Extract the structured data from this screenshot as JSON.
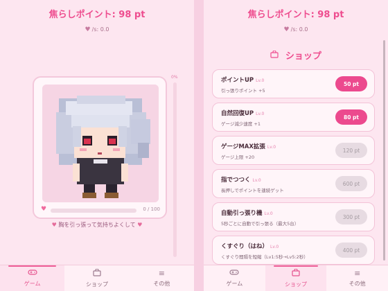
{
  "left": {
    "points_title": "焦らしポイント: 98 pt",
    "rate_icon": "heart",
    "rate_text": "/s: 0.0",
    "vbar_label": "0%",
    "gauge": {
      "text": "0 / 100",
      "value": 0,
      "max": 100
    },
    "hint": "胸を引っ張って気持ちよくして",
    "hint_icon": "heart"
  },
  "right": {
    "points_title": "焦らしポイント: 98 pt",
    "rate_text": "/s: 0.0",
    "shop_title": "ショップ",
    "items": [
      {
        "name": "ポイントUP",
        "lv": "Lv.0",
        "desc": "引っ張りポイント +5",
        "price": "50 pt",
        "affordable": true
      },
      {
        "name": "自然回復UP",
        "lv": "Lv.0",
        "desc": "ゲージ減少速度 +1",
        "price": "80 pt",
        "affordable": true
      },
      {
        "name": "ゲージMAX拡張",
        "lv": "Lv.0",
        "desc": "ゲージ上限 +20",
        "price": "120 pt",
        "affordable": false
      },
      {
        "name": "指でつつく",
        "lv": "Lv.0",
        "desc": "長押しでポイントを連続ゲット",
        "price": "600 pt",
        "affordable": false
      },
      {
        "name": "自動引っ張り機",
        "lv": "Lv.0",
        "desc": "5秒ごとに自動で引っ張る（最大5台）",
        "price": "300 pt",
        "affordable": false
      },
      {
        "name": "くすぐり（はね）",
        "lv": "Lv.0",
        "desc": "くすぐり間隔を短縮（Lv1:5秒→Lv5:2秒）",
        "price": "400 pt",
        "affordable": false
      }
    ]
  },
  "nav": {
    "game": "ゲーム",
    "shop": "ショップ",
    "other": "その他"
  },
  "icons": [
    "heart-icon",
    "gamepad-icon",
    "bag-icon",
    "menu-icon"
  ],
  "colors": {
    "accent": "#ee4d8f",
    "disabled": "#e7dbe2"
  }
}
